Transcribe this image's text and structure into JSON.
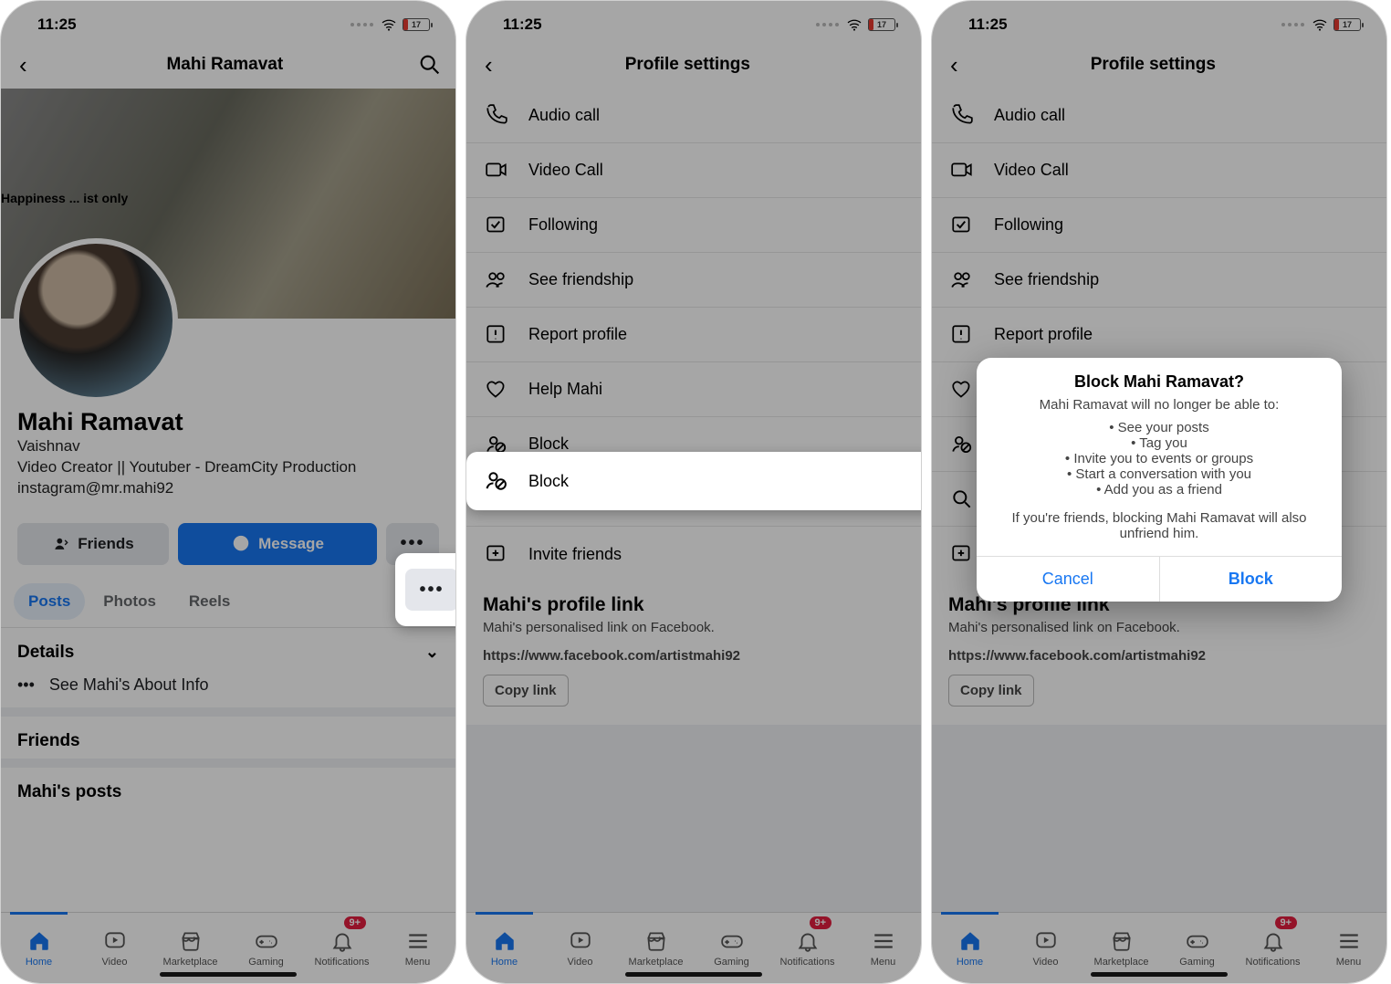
{
  "status": {
    "time": "11:25",
    "battery": "17"
  },
  "screen1": {
    "header_name": "Mahi Ramavat",
    "cover_text": "Happiness ... ist only",
    "profile_name": "Mahi Ramavat",
    "line1": "Vaishnav",
    "line2": "Video Creator  || Youtuber - DreamCity Production",
    "line3": "instagram@mr.mahi92",
    "btn_friends": "Friends",
    "btn_message": "Message",
    "tabs": {
      "posts": "Posts",
      "photos": "Photos",
      "reels": "Reels"
    },
    "details": "Details",
    "about": "See Mahi's About Info",
    "friends_hd": "Friends",
    "posts_hd": "Mahi's posts"
  },
  "screen2": {
    "title": "Profile settings",
    "items": {
      "audio": "Audio call",
      "video": "Video Call",
      "following": "Following",
      "friendship": "See friendship",
      "report": "Report profile",
      "help": "Help Mahi",
      "block": "Block",
      "search": "Search",
      "invite": "Invite friends"
    },
    "plink_title": "Mahi's profile link",
    "plink_sub": "Mahi's personalised link on Facebook.",
    "plink_url": "https://www.facebook.com/artistmahi92",
    "copy": "Copy link"
  },
  "dialog": {
    "title": "Block Mahi Ramavat?",
    "sub": "Mahi Ramavat will no longer be able to:",
    "items": [
      "See your posts",
      "Tag you",
      "Invite you to events or groups",
      "Start a conversation with you",
      "Add you as a friend"
    ],
    "note": "If you're friends, blocking Mahi Ramavat will also unfriend him.",
    "cancel": "Cancel",
    "block": "Block"
  },
  "bottom": {
    "home": "Home",
    "video": "Video",
    "market": "Marketplace",
    "gaming": "Gaming",
    "notif": "Notifications",
    "menu": "Menu",
    "badge": "9+"
  }
}
